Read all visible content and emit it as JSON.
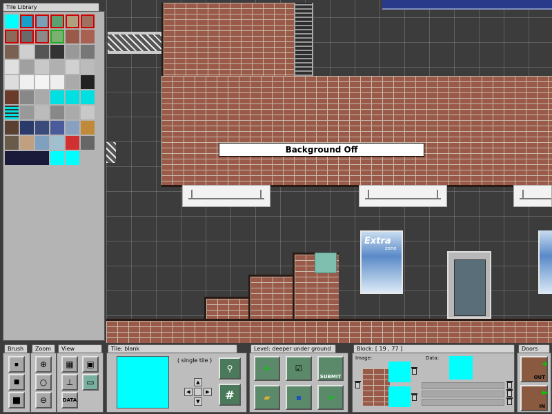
{
  "tile_library": {
    "title": "Tile Library"
  },
  "canvas": {
    "banner_text": "Background Off",
    "poster_title": "Extra",
    "poster_sub": "zone"
  },
  "brush": {
    "title": "Brush"
  },
  "zoom": {
    "title": "Zoom"
  },
  "view": {
    "title": "View",
    "data_label": "DATA"
  },
  "tile": {
    "title": "Tile:",
    "name": "blank",
    "mode": "( single tile )"
  },
  "level": {
    "title": "Level:",
    "name": "deeper under ground",
    "submit_label": "SUBMIT"
  },
  "block": {
    "title": "Block:",
    "coords": "[ 19 , 77 ]",
    "image_label": "Image:",
    "data_label": "Data:"
  },
  "doors": {
    "title": "Doors",
    "out_label": "OUT",
    "in_label": "IN"
  },
  "colors": {
    "selected": "#00ffff",
    "brick": "#9a5a4a",
    "panel": "#bdbdbd"
  }
}
